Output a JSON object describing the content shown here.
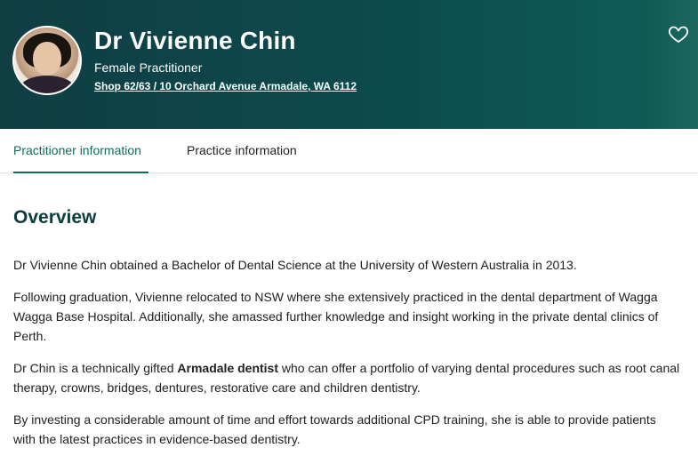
{
  "practitioner": {
    "name": "Dr Vivienne Chin",
    "gender_label": "Female Practitioner",
    "address": "Shop 62/63 / 10 Orchard Avenue Armadale, WA 6112"
  },
  "tabs": [
    {
      "label": "Practitioner information",
      "active": true
    },
    {
      "label": "Practice information",
      "active": false
    }
  ],
  "overview": {
    "title": "Overview",
    "p1": "Dr Vivienne Chin obtained a Bachelor of Dental Science at the University of Western Australia in 2013.",
    "p2": "Following graduation, Vivienne relocated to NSW where she extensively practiced in the dental department of Wagga Wagga Base Hospital. Additionally, she amassed further knowledge and insight working in the private dental clinics of Perth.",
    "p3_before": "Dr Chin is a technically gifted ",
    "p3_bold": "Armadale dentist",
    "p3_after": " who can offer a portfolio of varying dental procedures such as root canal therapy, crowns, bridges, dentures, restorative care and children dentistry.",
    "p4": "By investing a considerable amount of time and effort towards additional CPD training, she is able to provide patients with the latest practices in evidence-based dentistry."
  },
  "icons": {
    "favorite": "heart-outline-icon"
  },
  "colors": {
    "header_bg": "#0d4a4d",
    "accent": "#0f6b5e",
    "heading": "#0d3c3c"
  }
}
